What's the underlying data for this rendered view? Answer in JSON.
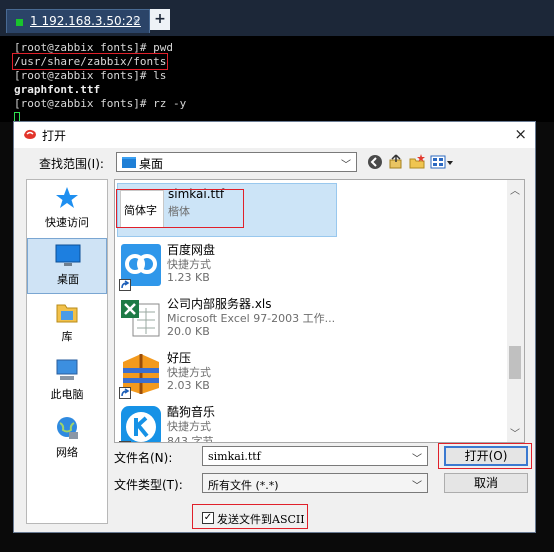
{
  "tab": {
    "title": "1 192.168.3.50:22",
    "close": "×",
    "new": "+"
  },
  "terminal": {
    "lines": [
      "[root@zabbix fonts]# pwd",
      "/usr/share/zabbix/fonts",
      "[root@zabbix fonts]# ls",
      "graphfont.ttf",
      "[root@zabbix fonts]# rz -y"
    ]
  },
  "dialog": {
    "title": "打开",
    "close": "×",
    "lookin_label": "查找范围(I):",
    "lookin_value": "桌面",
    "places": [
      {
        "label": "快速访问",
        "icon": "star-icon"
      },
      {
        "label": "桌面",
        "icon": "desktop-icon"
      },
      {
        "label": "库",
        "icon": "library-icon"
      },
      {
        "label": "此电脑",
        "icon": "computer-icon"
      },
      {
        "label": "网络",
        "icon": "network-icon"
      }
    ],
    "files": [
      {
        "name": "simkai.ttf",
        "sub1": "楷体",
        "sub2": "",
        "preview": "简体字"
      },
      {
        "name": "百度网盘",
        "sub1": "快捷方式",
        "sub2": "1.23 KB"
      },
      {
        "name": "公司内部服务器.xls",
        "sub1": "Microsoft Excel 97-2003 工作...",
        "sub2": "20.0 KB"
      },
      {
        "name": "好压",
        "sub1": "快捷方式",
        "sub2": "2.03 KB"
      },
      {
        "name": "酷狗音乐",
        "sub1": "快捷方式",
        "sub2": "843 字节"
      }
    ],
    "filename_label": "文件名(N):",
    "filename_value": "simkai.ttf",
    "filetype_label": "文件类型(T):",
    "filetype_value": "所有文件 (*.*)",
    "open_button": "打开(O)",
    "cancel_button": "取消",
    "ascii_label": "发送文件到ASCII",
    "ascii_checked": "✓"
  }
}
